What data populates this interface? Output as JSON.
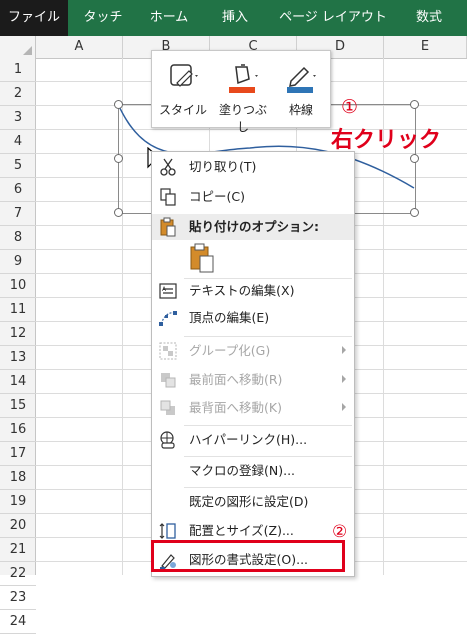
{
  "ribbon": {
    "tabs": [
      {
        "label": "ファイル",
        "active": true
      },
      {
        "label": "タッチ"
      },
      {
        "label": "ホーム"
      },
      {
        "label": "挿入"
      },
      {
        "label": "ページ レイアウト"
      },
      {
        "label": "数式"
      }
    ]
  },
  "columns": [
    "A",
    "B",
    "C",
    "D",
    "E"
  ],
  "rows": [
    "1",
    "2",
    "3",
    "4",
    "5",
    "6",
    "7",
    "8",
    "9",
    "10",
    "11",
    "12",
    "13",
    "14",
    "15",
    "16",
    "17",
    "18",
    "19",
    "20",
    "21",
    "22",
    "23",
    "24"
  ],
  "mini_toolbar": {
    "style_label": "スタイル",
    "fill_label": "塗りつぶし",
    "outline_label": "枠線"
  },
  "annotations": {
    "step1": "①",
    "right_click": "右クリック",
    "step2": "②"
  },
  "context_menu": {
    "cut": "切り取り(T)",
    "copy": "コピー(C)",
    "paste_options": "貼り付けのオプション:",
    "edit_text": "テキストの編集(X)",
    "edit_points": "頂点の編集(E)",
    "group": "グループ化(G)",
    "bring_to_front": "最前面へ移動(R)",
    "send_to_back": "最背面へ移動(K)",
    "hyperlink": "ハイパーリンク(H)...",
    "assign_macro": "マクロの登録(N)...",
    "set_default_shape": "既定の図形に設定(D)",
    "size_properties": "配置とサイズ(Z)...",
    "format_shape": "図形の書式設定(O)..."
  },
  "colors": {
    "excel_green": "#217346",
    "annotation_red": "#e0001b",
    "fill_orange": "#e8491c",
    "outline_blue": "#2e75b6"
  }
}
